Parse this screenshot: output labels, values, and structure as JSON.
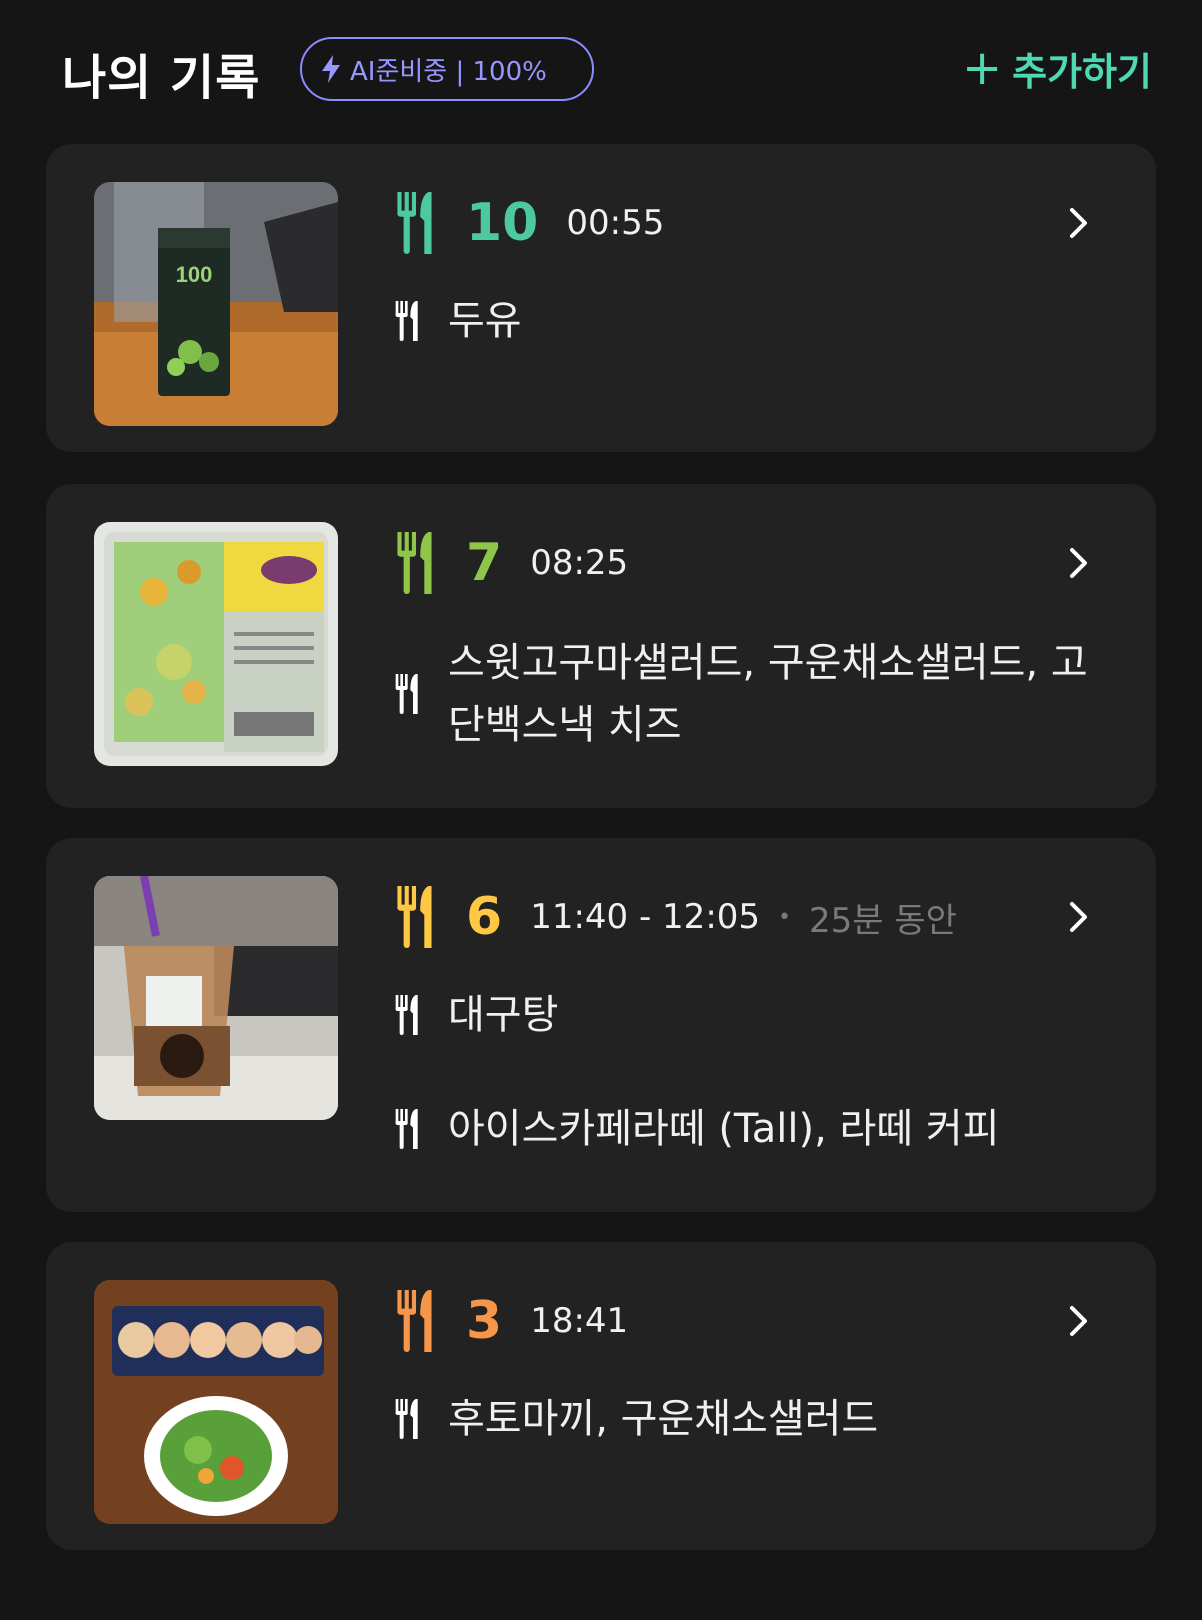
{
  "header": {
    "title": "나의 기록",
    "ai_badge": "AI준비중 | 100%",
    "add_label": "추가하기",
    "plus_glyph": "+",
    "icons": {
      "badge": "lightning-icon"
    }
  },
  "colors": {
    "background": "#151515",
    "card": "#222222",
    "accent_teal": "#4fd8b4",
    "badge_purple": "#8c8cff"
  },
  "meals": [
    {
      "count": "10",
      "time": "00:55",
      "color": "#4cc9a0",
      "foods": [
        "두유"
      ],
      "photo": "soy-milk-carton-photo"
    },
    {
      "count": "7",
      "time": "08:25",
      "color": "#8fc64a",
      "foods": [
        "스윗고구마샐러드, 구운채소샐러드, 고단백스낵 치즈"
      ],
      "photo": "salad-package-photo"
    },
    {
      "count": "6",
      "time": "11:40 - 12:05",
      "duration_sep": "•",
      "duration": "25분 동안",
      "color": "#ffc844",
      "foods": [
        "대구탕",
        "아이스카페라떼 (Tall), 라떼 커피"
      ],
      "photo": "iced-latte-cup-photo"
    },
    {
      "count": "3",
      "time": "18:41",
      "color": "#f5964a",
      "foods": [
        "후토마끼, 구운채소샐러드"
      ],
      "photo": "kimbap-and-salad-photo"
    }
  ]
}
